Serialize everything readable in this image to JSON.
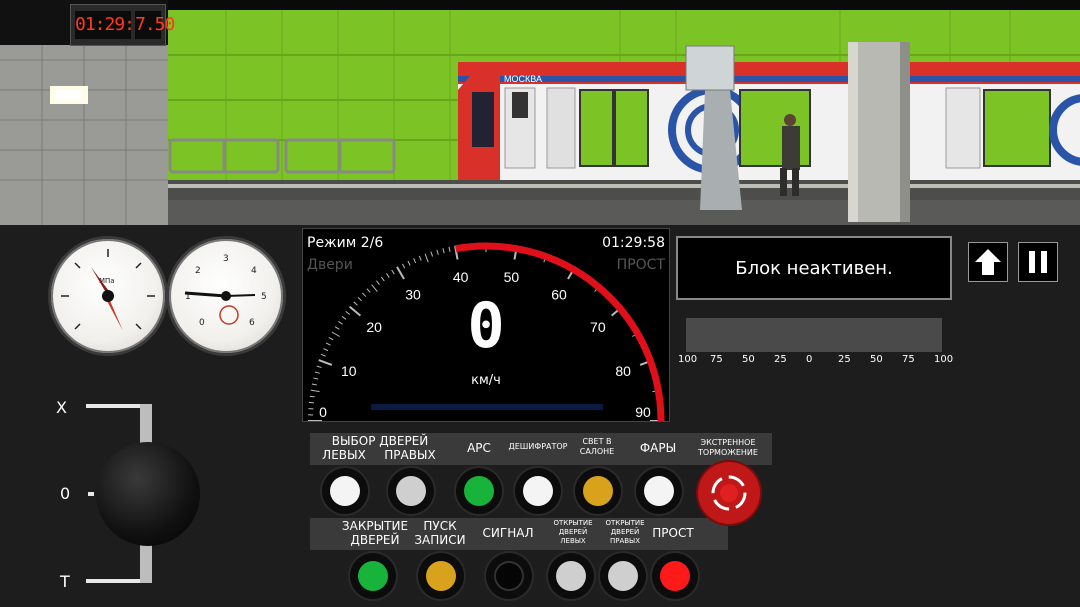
{
  "hud": {
    "clock": "01:29:58",
    "value": "7.50"
  },
  "speedometer": {
    "mode": "Режим 2/6",
    "doors": "Двери",
    "time": "01:29:58",
    "status": "ПРОСТ",
    "speed": "0",
    "unit": "км/ч",
    "ticks": [
      "0",
      "10",
      "20",
      "30",
      "40",
      "50",
      "60",
      "70",
      "80",
      "90"
    ],
    "max_speed": 90,
    "speed_limit_from": 40
  },
  "block_message": "Блок неактивен.",
  "load_scale": [
    "100",
    "75",
    "50",
    "25",
    "0",
    "25",
    "50",
    "75",
    "100"
  ],
  "controller": {
    "labels": [
      "X",
      "0",
      "T"
    ]
  },
  "gauges": [
    {
      "name": "brake-pressure-gauge",
      "text": "МПа"
    },
    {
      "name": "line-pressure-gauge",
      "ticks": [
        "0",
        "1",
        "2",
        "3",
        "4",
        "5",
        "6"
      ]
    }
  ],
  "row1": {
    "door_select_title": "ВЫБОР ДВЕРЕЙ",
    "left": "ЛЕВЫХ",
    "right": "ПРАВЫХ",
    "ars": "АРС",
    "decoder": "ДЕШИФРАТОР",
    "light": "СВЕТ В САЛОНЕ",
    "headlights": "ФАРЫ",
    "emergency": "ЭКСТРЕННОЕ ТОРМОЖЕНИЕ"
  },
  "row2": {
    "close_doors": "ЗАКРЫТИЕ ДВЕРЕЙ",
    "start_rec": "ПУСК ЗАПИСИ",
    "signal": "СИГНАЛ",
    "open_left": "ОТКРЫТИЕ ДВЕРЕЙ ЛЕВЫХ",
    "open_right": "ОТКРЫТИЕ ДВЕРЕЙ ПРАВЫХ",
    "prost": "ПРОСТ"
  },
  "colors": {
    "lamp_white": "#f4f4f4",
    "lamp_grey": "#cfcfcf",
    "lamp_green": "#18b33a",
    "lamp_amber": "#d8a21c",
    "lamp_black": "#050505",
    "lamp_red": "#ff1a1a",
    "speed_arc": "#e0101a",
    "platform_wall": "#7cc425",
    "train_red": "#d9312a"
  },
  "scene": {
    "train_name": "МОСКВА"
  }
}
